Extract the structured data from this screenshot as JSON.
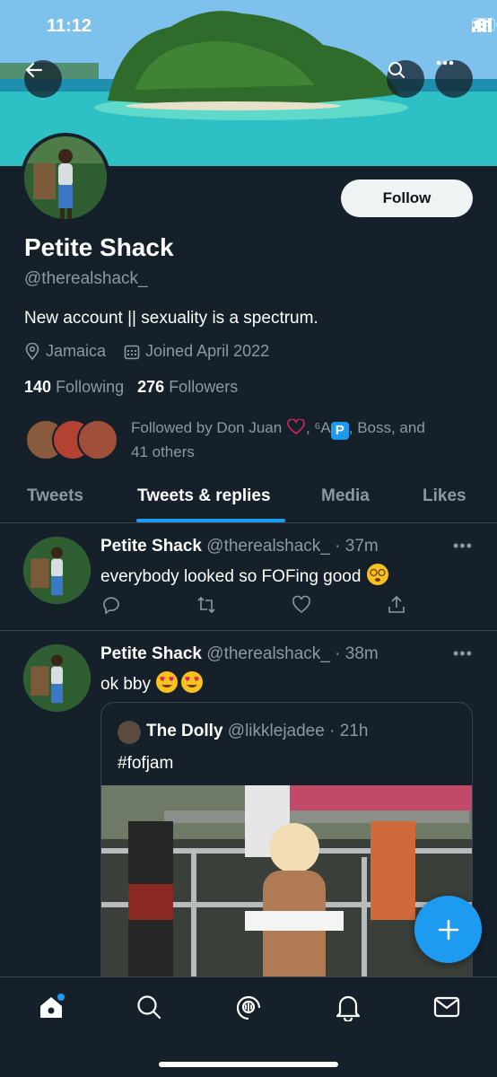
{
  "status_bar": {
    "time": "11:12"
  },
  "profile": {
    "name": "Petite Shack",
    "handle": "@therealshack_",
    "bio": "New account || sexuality is a spectrum.",
    "location": "Jamaica",
    "joined": "Joined April 2022",
    "following_count": "140",
    "following_label": "Following",
    "followers_count": "276",
    "followers_label": "Followers",
    "follow_button": "Follow",
    "followed_by_prefix": "Followed by Don Juan",
    "followed_by_mid": ", ⁶A",
    "followed_by_badge": "P",
    "followed_by_suffix": ", Boss, and",
    "followed_by_line2": "41 others"
  },
  "tabs": [
    {
      "label": "Tweets"
    },
    {
      "label": "Tweets & replies"
    },
    {
      "label": "Media"
    },
    {
      "label": "Likes"
    }
  ],
  "tweets": [
    {
      "name": "Petite Shack",
      "meta": "@therealshack_ · 37m",
      "text": "everybody looked so FOFing good",
      "more": "•••"
    },
    {
      "name": "Petite Shack",
      "meta": "@therealshack_ · 38m",
      "text": "ok bby",
      "more": "•••",
      "quote": {
        "name": "The Dolly",
        "meta": "@likklejadee · 21h",
        "text": "#fofjam"
      }
    }
  ],
  "colors": {
    "background": "#15202b",
    "accent": "#1d9bf0",
    "secondary_text": "#8b98a5",
    "divider": "#38444d"
  },
  "icons": {
    "back": "back-arrow-icon",
    "search": "search-icon",
    "more": "more-icon",
    "location": "location-pin-icon",
    "calendar": "calendar-icon",
    "reply": "reply-icon",
    "retweet": "retweet-icon",
    "like": "heart-icon",
    "share": "share-icon",
    "compose": "plus-icon",
    "nav": [
      "home-icon",
      "search-icon",
      "spaces-icon",
      "bell-icon",
      "mail-icon"
    ]
  }
}
